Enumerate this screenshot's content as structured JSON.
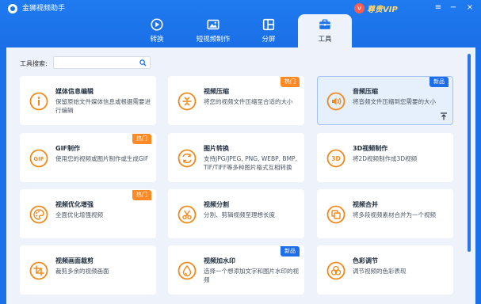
{
  "app": {
    "title": "金狮视频助手"
  },
  "vip": {
    "badge": "V",
    "label": "尊贵VIP"
  },
  "window": {
    "menu": "≡",
    "minimize": "−",
    "close": "×"
  },
  "nav": {
    "tabs": [
      {
        "label": "转换",
        "icon": "convert-icon"
      },
      {
        "label": "短视频制作",
        "icon": "short-video-icon"
      },
      {
        "label": "分屏",
        "icon": "split-screen-icon"
      },
      {
        "label": "工具",
        "icon": "toolbox-icon",
        "active": true
      }
    ]
  },
  "search": {
    "label": "工具搜索:",
    "value": "",
    "placeholder": ""
  },
  "colors": {
    "brand": "#1a72e8",
    "hot": "#ff8a25",
    "new": "#1d6ee8",
    "icon": "#f08a1c"
  },
  "tools": [
    {
      "title": "媒体信息编辑",
      "desc": "保留原始文件媒体信息或根据需要进行编辑",
      "icon": "info-icon",
      "tag": ""
    },
    {
      "title": "视频压缩",
      "desc": "将您的视频文件压缩至合适的大小",
      "icon": "video-compress-icon",
      "tag": "热门"
    },
    {
      "title": "音频压缩",
      "desc": "将音频文件压缩到您需要的大小",
      "icon": "audio-compress-icon",
      "tag": "新品",
      "selected": true
    },
    {
      "title": "GIF制作",
      "desc": "使用您的视频或图片制作或生成GIF",
      "icon": "gif-icon",
      "tag": "热门"
    },
    {
      "title": "图片转换",
      "desc": "支持JPG/JPEG, PNG, WEBP, BMP, TIF/TIFF等多种图片格式互相转换",
      "icon": "image-convert-icon",
      "tag": ""
    },
    {
      "title": "3D视频制作",
      "desc": "将2D视频制作成3D视频",
      "icon": "3d-icon",
      "tag": ""
    },
    {
      "title": "视频优化增强",
      "desc": "全面优化增强视频",
      "icon": "palette-icon",
      "tag": "热门"
    },
    {
      "title": "视频分割",
      "desc": "分割、剪辑视频至理想长度",
      "icon": "scissors-icon",
      "tag": ""
    },
    {
      "title": "视频合并",
      "desc": "将多段视频素材合并为一个视频",
      "icon": "merge-icon",
      "tag": ""
    },
    {
      "title": "视频画面裁剪",
      "desc": "裁剪多余的视频画面",
      "icon": "crop-icon",
      "tag": ""
    },
    {
      "title": "视频加水印",
      "desc": "选择一个想添加文字和图片水印的视频",
      "icon": "watermark-icon",
      "tag": "新品"
    },
    {
      "title": "色彩调节",
      "desc": "调节视频的色彩表现",
      "icon": "color-adjust-icon",
      "tag": ""
    }
  ]
}
